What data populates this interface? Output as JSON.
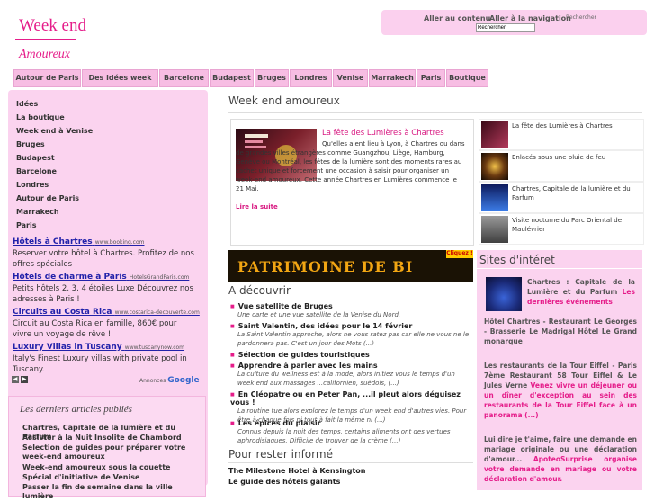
{
  "header": {
    "title": "Week end",
    "subtitle": "Amoureux",
    "access": {
      "content_link": "Aller au contenu",
      "nav_link": "Aller à la navigation",
      "search_label": "Rechercher",
      "search_value": "Rechercher"
    }
  },
  "nav": {
    "tabs": [
      "Autour de Paris",
      "Des idées week end",
      "Barcelone",
      "Budapest",
      "Bruges",
      "Londres",
      "Venise",
      "Marrakech",
      "Paris",
      "Boutique"
    ]
  },
  "sidebar": {
    "items": [
      "Idées",
      "La boutique",
      "Week end à Venise",
      "Bruges",
      "Budapest",
      "Barcelone",
      "Londres",
      "Autour de Paris",
      "Marrakech",
      "Paris"
    ],
    "ads": [
      {
        "title": "Hôtels à Chartres",
        "url": "www.booking.com",
        "text": "Reserver votre hôtel à Chartres. Profitez de nos offres spéciales !"
      },
      {
        "title": "Hôtels de charme à Paris",
        "url": "HotelsGrandParis.com",
        "text": "Petits hôtels 2, 3, 4 étoiles Luxe Découvrez nos adresses à Paris !"
      },
      {
        "title": "Circuits au Costa Rica",
        "url": "www.costarica-decouverte.com",
        "text": "Circuit au Costa Rica en famille, 860€ pour vivre un voyage de rêve !"
      },
      {
        "title": "Luxury Villas in Tuscany",
        "url": "www.tuscanynow.com",
        "text": "Italy's Finest Luxury villas with private pool in Tuscany."
      }
    ],
    "ads_label": "Annonces",
    "ads_brand": "Google",
    "prev_icon": "◀",
    "next_icon": "▶"
  },
  "recent": {
    "title": "Les derniers articles publiés",
    "items": [
      "Chartres, Capitale de la lumière et du Parfum",
      "Assister à la Nuit Insolite de Chambord",
      "Selection de guides pour préparer votre week-end amoureux",
      "Week-end amoureux sous la couette",
      "Spécial d'initiative de Venise",
      "Passer la fin de semaine dans la ville lumière"
    ]
  },
  "main": {
    "title": "Week end amoureux",
    "feature": {
      "title": "La fête des Lumières à Chartres",
      "text": "Qu'elles aient lieu à Lyon, à Chartres ou dans de grandes villes étrangères comme Guangzhou, Liège, Hamburg, Genève ou Montréal, les fêtes de la lumière sont des moments rares au cachet unique et forcement une occasion à saisir pour organiser un week-end amoureux. Cette année Chartres en Lumières commence le 21 Mai.",
      "more": "Lire la suite"
    },
    "thumbs": [
      "La fête des Lumières à Chartres",
      "Enlacés sous une pluie de feu",
      "Chartres, Capitale de la lumière et du Parfum",
      "Visite nocturne du Parc Oriental de Maulévrier"
    ],
    "banner": {
      "text": "PATRIMOINE DE BI",
      "click": "Cliquez !"
    },
    "discover": {
      "title": "A découvrir",
      "items": [
        {
          "head": "Vue satellite de Bruges",
          "desc": "Une carte et une vue satellite de la Venise du Nord."
        },
        {
          "head": "Saint Valentin, des idées pour le 14 février",
          "desc": "La Saint Valentin approche, alors ne vous ratez pas car elle ne vous ne le pardonnera pas. C'est un jour des Mots (...)"
        },
        {
          "head": "Sélection de guides touristiques",
          "desc": ""
        },
        {
          "head": "Apprendre à parler avec les mains",
          "desc": "La culture du wellness est à la mode, alors initiez vous le temps d'un week end aux massages ...californien, suédois, (...)"
        },
        {
          "head": "En Cléopatre ou en Peter Pan, ...il pleut alors déguisez vous !",
          "desc": "La routine tue alors explorez le temps d'un week end d'autres vies. Pour être à chaque fois ni tout à fait la même ni (...)"
        },
        {
          "head": "Les épices du plaisir",
          "desc": "Connus depuis la nuit des temps, certains aliments ont des vertues aphrodisiaques. Difficile de trouver de la crème (...)"
        }
      ]
    },
    "stay": {
      "title": "Pour rester informé",
      "items": [
        "The Milestone Hotel à Kensington",
        "Le guide des hôtels galants"
      ]
    }
  },
  "interest": {
    "title": "Sites d'intéret",
    "lead": "Chartres : Capitale de la Lumière et du Parfum",
    "lead_pink": "Les dernières événements",
    "block1": "Hôtel Chartres - Restaurant Le Georges - Brasserie Le Madrigal Hôtel Le Grand monarque",
    "block2": "Les restaurants de la Tour Eiffel - Paris 7ème Restaurant 58 Tour Eiffel & Le Jules Verne",
    "block2_pink": "Venez vivre un déjeuner ou un dîner d'exception au sein des restaurants de la Tour Eiffel face à un panorama (...)",
    "block3": "Lui dire je t'aime, faire une demande en mariage originale ou une déclaration d'amour...",
    "block3_pink": "ApoteoSurprise organise votre demande en mariage ou votre déclaration d'amour."
  }
}
